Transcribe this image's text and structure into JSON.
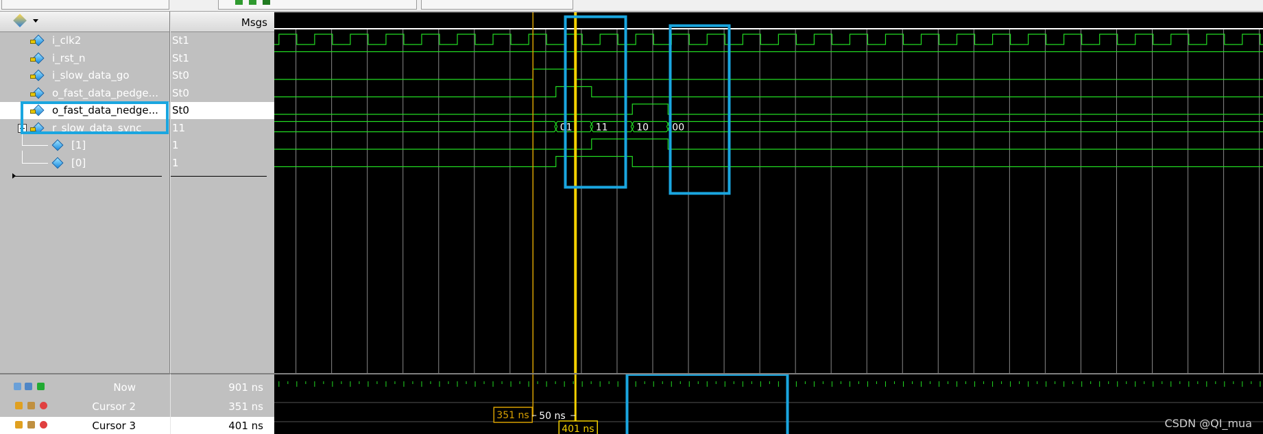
{
  "msgs_header": "Msgs",
  "signals": [
    {
      "name": "i_clk2",
      "value": "St1",
      "indent": 1,
      "icon": "signal-diamond-icon"
    },
    {
      "name": "i_rst_n",
      "value": "St1",
      "indent": 1,
      "icon": "signal-diamond-icon"
    },
    {
      "name": "i_slow_data_go",
      "value": "St0",
      "indent": 1,
      "icon": "signal-diamond-icon"
    },
    {
      "name": "o_fast_data_pedge...",
      "value": "St0",
      "indent": 1,
      "icon": "signal-diamond-icon"
    },
    {
      "name": "o_fast_data_nedge...",
      "value": "St0",
      "indent": 1,
      "icon": "signal-diamond-icon",
      "selected": true
    },
    {
      "name": "r_slow_data_sync",
      "value": "11",
      "indent": 1,
      "icon": "signal-diamond-icon",
      "expandable": true
    },
    {
      "name": "[1]",
      "value": "1",
      "indent": 2,
      "icon": "signal-diamond-icon"
    },
    {
      "name": "[0]",
      "value": "1",
      "indent": 2,
      "icon": "signal-diamond-icon"
    }
  ],
  "bus_values": [
    {
      "at_ns": 0,
      "label": "00"
    },
    {
      "at_ns": 378,
      "label": "01"
    },
    {
      "at_ns": 408,
      "label": "11"
    },
    {
      "at_ns": 468,
      "label": "10"
    },
    {
      "at_ns": 498,
      "label": "00"
    }
  ],
  "cursors": [
    {
      "name": "Now",
      "value": "901 ns"
    },
    {
      "name": "Cursor 2",
      "value": "351 ns"
    },
    {
      "name": "Cursor 3",
      "value": "401 ns",
      "selected": true
    }
  ],
  "cursor_markers": {
    "cursor2_label": "351 ns",
    "cursor3_label": "401 ns",
    "delta_label": "50 ns",
    "cursor2_ns": 351,
    "cursor3_ns": 401
  },
  "colors": {
    "wave": "#22dd22",
    "grid": "#8a8a8a",
    "cursor2": "#d8a000",
    "cursor3": "#f5d000",
    "highlight_box": "#1aa6e0"
  },
  "watermark": "CSDN @QI_mua"
}
